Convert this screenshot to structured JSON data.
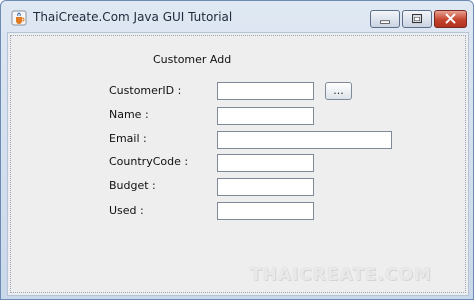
{
  "window": {
    "title": "ThaiCreate.Com Java GUI Tutorial",
    "icon": "java-cup-icon",
    "controls": [
      "minimize-icon",
      "maximize-icon",
      "close-icon"
    ]
  },
  "form": {
    "heading": "Customer Add",
    "fields": [
      {
        "label": "CustomerID :",
        "value": ""
      },
      {
        "label": "Name :",
        "value": ""
      },
      {
        "label": "Email :",
        "value": ""
      },
      {
        "label": "CountryCode :",
        "value": ""
      },
      {
        "label": "Budget :",
        "value": ""
      },
      {
        "label": "Used :",
        "value": ""
      }
    ],
    "browse_label": "..."
  },
  "watermark": "THAICREATE.COM",
  "colors": {
    "title_bar": "#c9d8ea",
    "client_background": "#eeeeee",
    "close_button": "#c4432e"
  }
}
